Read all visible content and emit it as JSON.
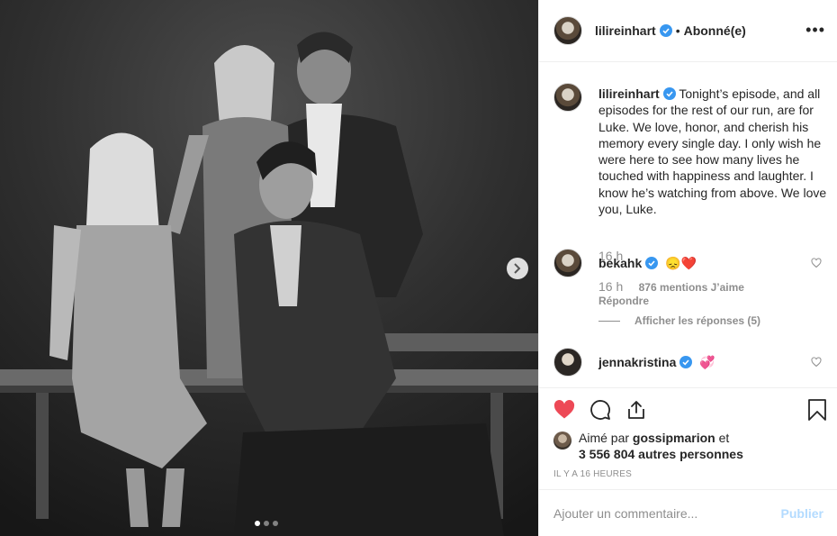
{
  "post": {
    "carousel": {
      "current_slide": 1,
      "total_slides": 3
    }
  },
  "header": {
    "username": "lilireinhart",
    "separator": "•",
    "follow_status": "Abonné(e)",
    "more_label": "•••"
  },
  "caption": {
    "username": "lilireinhart",
    "text": "Tonight’s episode, and all episodes for the rest of our run, are for Luke. We love, honor, and cherish his memory every single day. I only wish he were here to see how many lives he touched with happiness and laughter. I know he’s watching from above. We love you, Luke.",
    "time": "16 h"
  },
  "comments": [
    {
      "username": "bekahk",
      "text": "😞❤️",
      "time": "16 h",
      "likes": "876 mentions J’aime",
      "reply_label": "Répondre",
      "view_replies": "Afficher les réponses (5)"
    },
    {
      "username": "jennakristina",
      "text": "💞"
    }
  ],
  "actions": {
    "liked_by_prefix": "Aimé par",
    "liked_by_user": "gossipmarion",
    "liked_by_suffix": "et",
    "others": "3 556 804 autres personnes",
    "timestamp": "Il y a 16 heures"
  },
  "add_comment": {
    "placeholder": "Ajouter un commentaire...",
    "publish_label": "Publier"
  },
  "colors": {
    "like_red": "#ed4956",
    "verified_blue": "#3897f0",
    "muted_text": "#8e8e8e",
    "publish_disabled": "#b3dbff"
  }
}
